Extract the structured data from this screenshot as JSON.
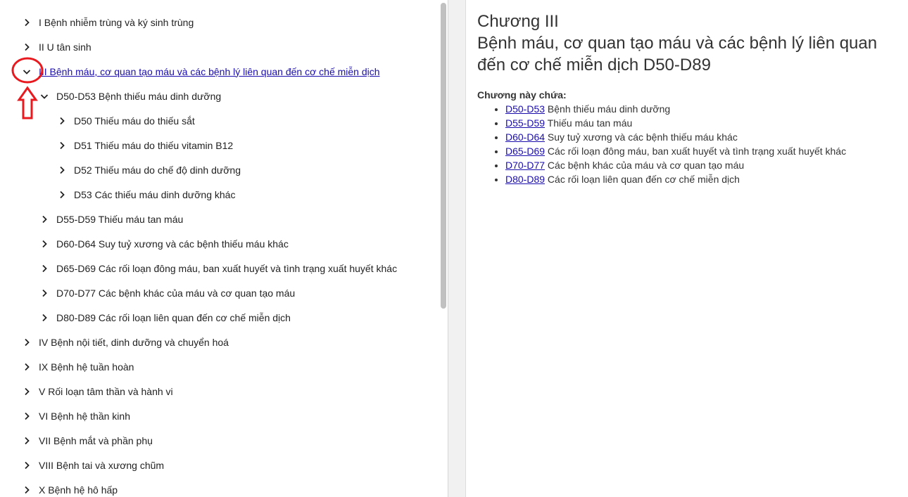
{
  "tree": {
    "items": [
      {
        "label": "I Bệnh nhiễm trùng và ký sinh trùng",
        "expanded": false
      },
      {
        "label": "II U tân sinh",
        "expanded": false
      },
      {
        "label": "III Bệnh máu, cơ quan tạo máu và các bệnh lý liên quan đến cơ chế miễn dịch",
        "expanded": true,
        "link": true
      },
      {
        "label": "D50-D53 Bệnh thiếu máu dinh dưỡng",
        "expanded": true
      },
      {
        "label": "D50 Thiếu máu do thiếu sắt",
        "expanded": false
      },
      {
        "label": "D51 Thiếu máu do thiếu vitamin B12",
        "expanded": false
      },
      {
        "label": "D52 Thiếu máu do chế độ dinh dưỡng",
        "expanded": false
      },
      {
        "label": "D53 Các thiếu máu dinh dưỡng khác",
        "expanded": false
      },
      {
        "label": "D55-D59 Thiếu máu tan máu",
        "expanded": false
      },
      {
        "label": "D60-D64 Suy tuỷ xương và các bệnh thiếu máu khác",
        "expanded": false
      },
      {
        "label": "D65-D69 Các rối loạn đông máu, ban xuất huyết và tình trạng xuất huyết khác",
        "expanded": false
      },
      {
        "label": "D70-D77 Các bệnh khác của máu và cơ quan tạo máu",
        "expanded": false
      },
      {
        "label": "D80-D89 Các rối loạn liên quan đến cơ chế miễn dịch",
        "expanded": false
      },
      {
        "label": "IV Bệnh nội tiết, dinh dưỡng và chuyển hoá",
        "expanded": false
      },
      {
        "label": "IX Bệnh hệ tuần hoàn",
        "expanded": false
      },
      {
        "label": "V Rối loạn tâm thần và hành vi",
        "expanded": false
      },
      {
        "label": "VI Bệnh hệ thần kinh",
        "expanded": false
      },
      {
        "label": "VII Bệnh mắt và phần phụ",
        "expanded": false
      },
      {
        "label": "VIII Bệnh tai và xương chũm",
        "expanded": false
      },
      {
        "label": "X Bệnh hệ hô hấp",
        "expanded": false
      }
    ]
  },
  "content": {
    "chapter_number": "Chương III",
    "chapter_title": "Bệnh máu, cơ quan tạo máu và các bệnh lý liên quan đến cơ chế miễn dịch D50-D89",
    "contains_label": "Chương này chứa:",
    "items": [
      {
        "code": "D50-D53",
        "text": "Bệnh thiếu máu dinh dưỡng"
      },
      {
        "code": "D55-D59",
        "text": "Thiếu máu tan máu"
      },
      {
        "code": "D60-D64",
        "text": "Suy tuỷ xương và các bệnh thiếu máu khác"
      },
      {
        "code": "D65-D69",
        "text": "Các rối loạn đông máu, ban xuất huyết và tình trạng xuất huyết khác"
      },
      {
        "code": "D70-D77",
        "text": "Các bệnh khác của máu và cơ quan tạo máu"
      },
      {
        "code": "D80-D89",
        "text": "Các rối loạn liên quan đến cơ chế miễn dịch"
      }
    ]
  },
  "colors": {
    "link": "#1a0dab",
    "annotation": "#e8191f",
    "scrollbar_thumb": "#c1c1c1",
    "gutter": "#f1f1f1"
  },
  "icons": {
    "collapsed": "chevron-right-icon",
    "expanded": "chevron-down-icon",
    "annotation": "red-circle-and-up-arrow"
  }
}
